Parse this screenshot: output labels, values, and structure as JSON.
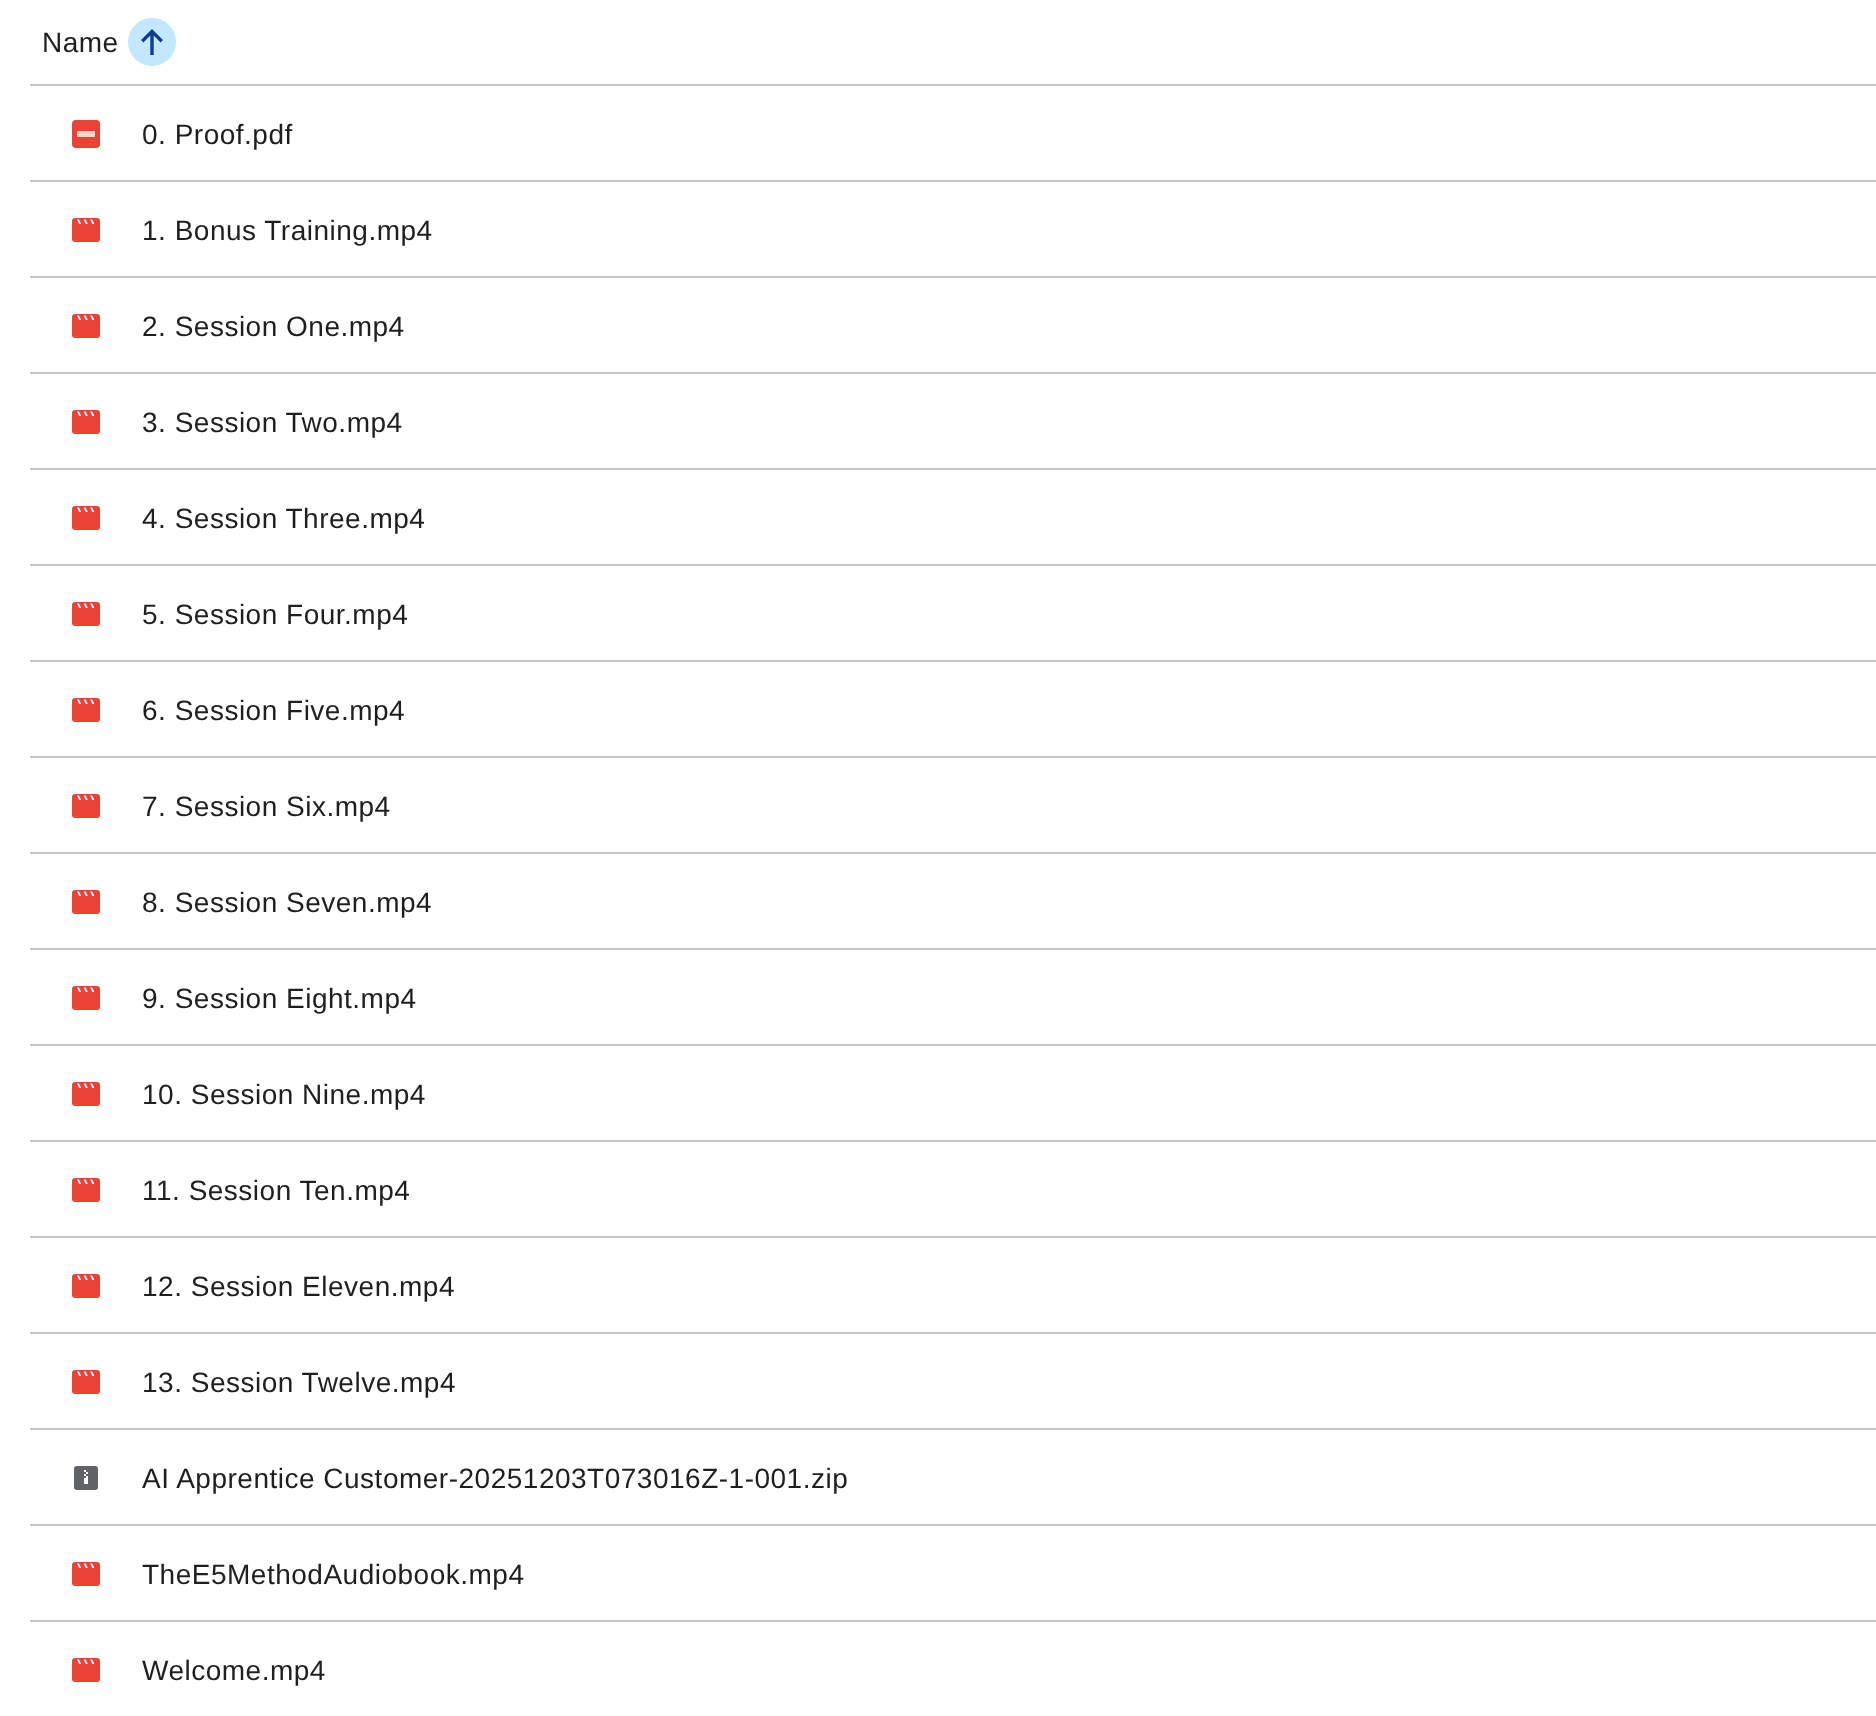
{
  "header": {
    "label": "Name",
    "sort_ascending": true
  },
  "files": [
    {
      "name": "0. Proof.pdf",
      "kind": "pdf"
    },
    {
      "name": "1. Bonus Training.mp4",
      "kind": "video"
    },
    {
      "name": "2. Session One.mp4",
      "kind": "video"
    },
    {
      "name": "3. Session Two.mp4",
      "kind": "video"
    },
    {
      "name": "4. Session Three.mp4",
      "kind": "video"
    },
    {
      "name": "5. Session Four.mp4",
      "kind": "video"
    },
    {
      "name": "6. Session Five.mp4",
      "kind": "video"
    },
    {
      "name": "7. Session Six.mp4",
      "kind": "video"
    },
    {
      "name": "8. Session Seven.mp4",
      "kind": "video"
    },
    {
      "name": "9. Session Eight.mp4",
      "kind": "video"
    },
    {
      "name": "10. Session Nine.mp4",
      "kind": "video"
    },
    {
      "name": "11. Session Ten.mp4",
      "kind": "video"
    },
    {
      "name": "12. Session Eleven.mp4",
      "kind": "video"
    },
    {
      "name": "13. Session Twelve.mp4",
      "kind": "video"
    },
    {
      "name": "AI Apprentice Customer-20251203T073016Z-1-001.zip",
      "kind": "zip"
    },
    {
      "name": "TheE5MethodAudiobook.mp4",
      "kind": "video"
    },
    {
      "name": "Welcome.mp4",
      "kind": "video"
    }
  ]
}
